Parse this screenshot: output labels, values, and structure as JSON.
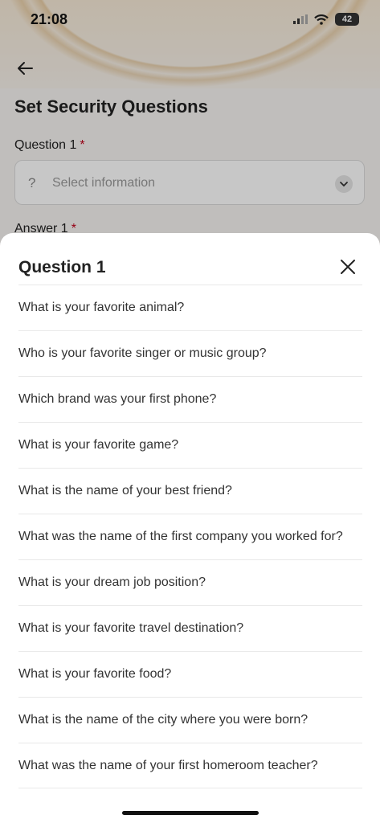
{
  "status_bar": {
    "time": "21:08",
    "battery": "42"
  },
  "background": {
    "title": "Set Security Questions",
    "question_label": "Question 1",
    "required_mark": "*",
    "select_icon_text": "?",
    "select_placeholder": "Select information",
    "answer_label": "Answer 1"
  },
  "sheet": {
    "title": "Question 1",
    "options": [
      "What is your favorite animal?",
      "Who is your favorite singer or music group?",
      "Which brand was your first phone?",
      "What is your favorite game?",
      "What is the name of your best friend?",
      "What was the name of the first company you worked for?",
      "What is your dream job position?",
      "What is your favorite travel destination?",
      "What is your favorite food?",
      "What is the name of the city where you were born?",
      "What was the name of your first homeroom teacher?"
    ]
  },
  "colors": {
    "required": "#c0001a",
    "accent_art": "#cd9646"
  },
  "icons": [
    "back-arrow-icon",
    "chevron-down-icon",
    "close-icon",
    "signal-icon",
    "wifi-icon",
    "battery-icon"
  ]
}
